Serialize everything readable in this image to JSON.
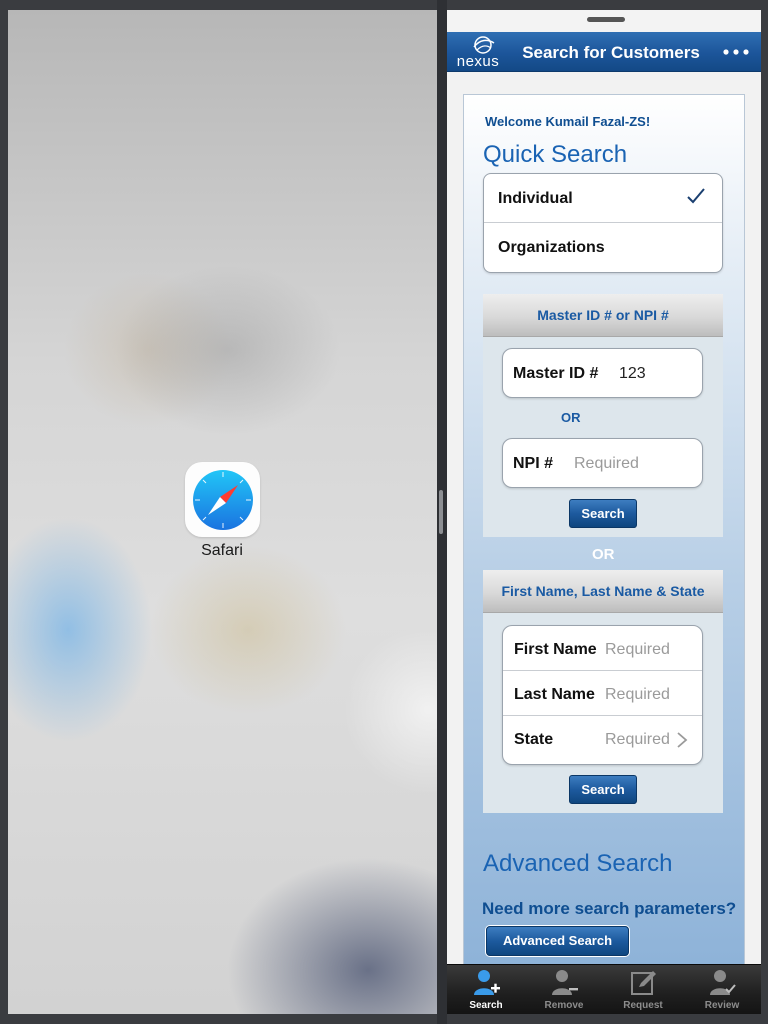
{
  "home_screen": {
    "app_icon": {
      "name": "compass-icon",
      "label": "Safari"
    }
  },
  "nav": {
    "logo_text": "nexus",
    "title": "Search for Customers",
    "more_icon": "more-dots-icon"
  },
  "welcome": "Welcome Kumail Fazal-ZS!",
  "quick_search": {
    "title": "Quick Search",
    "options": [
      {
        "label": "Individual",
        "selected": true
      },
      {
        "label": "Organizations",
        "selected": false
      }
    ]
  },
  "id_search": {
    "header": "Master ID # or NPI #",
    "master_id_label": "Master ID #",
    "master_id_value": "123",
    "or_label": "OR",
    "npi_label": "NPI #",
    "npi_placeholder": "Required",
    "search_label": "Search"
  },
  "or_divider": "OR",
  "name_search": {
    "header": "First Name, Last Name & State",
    "first_name_label": "First Name",
    "first_name_placeholder": "Required",
    "last_name_label": "Last Name",
    "last_name_placeholder": "Required",
    "state_label": "State",
    "state_value": "Required",
    "search_label": "Search"
  },
  "advanced": {
    "title": "Advanced Search",
    "question": "Need more search parameters?",
    "button_label": "Advanced Search"
  },
  "tabs": [
    {
      "label": "Search",
      "icon": "user-add-icon",
      "active": true
    },
    {
      "label": "Remove",
      "icon": "user-remove-icon",
      "active": false
    },
    {
      "label": "Request",
      "icon": "edit-icon",
      "active": false
    },
    {
      "label": "Review",
      "icon": "user-check-icon",
      "active": false
    }
  ],
  "colors": {
    "brand_blue": "#1c559a",
    "accent_blue": "#1a63b3",
    "tab_active": "#3a9bea"
  }
}
